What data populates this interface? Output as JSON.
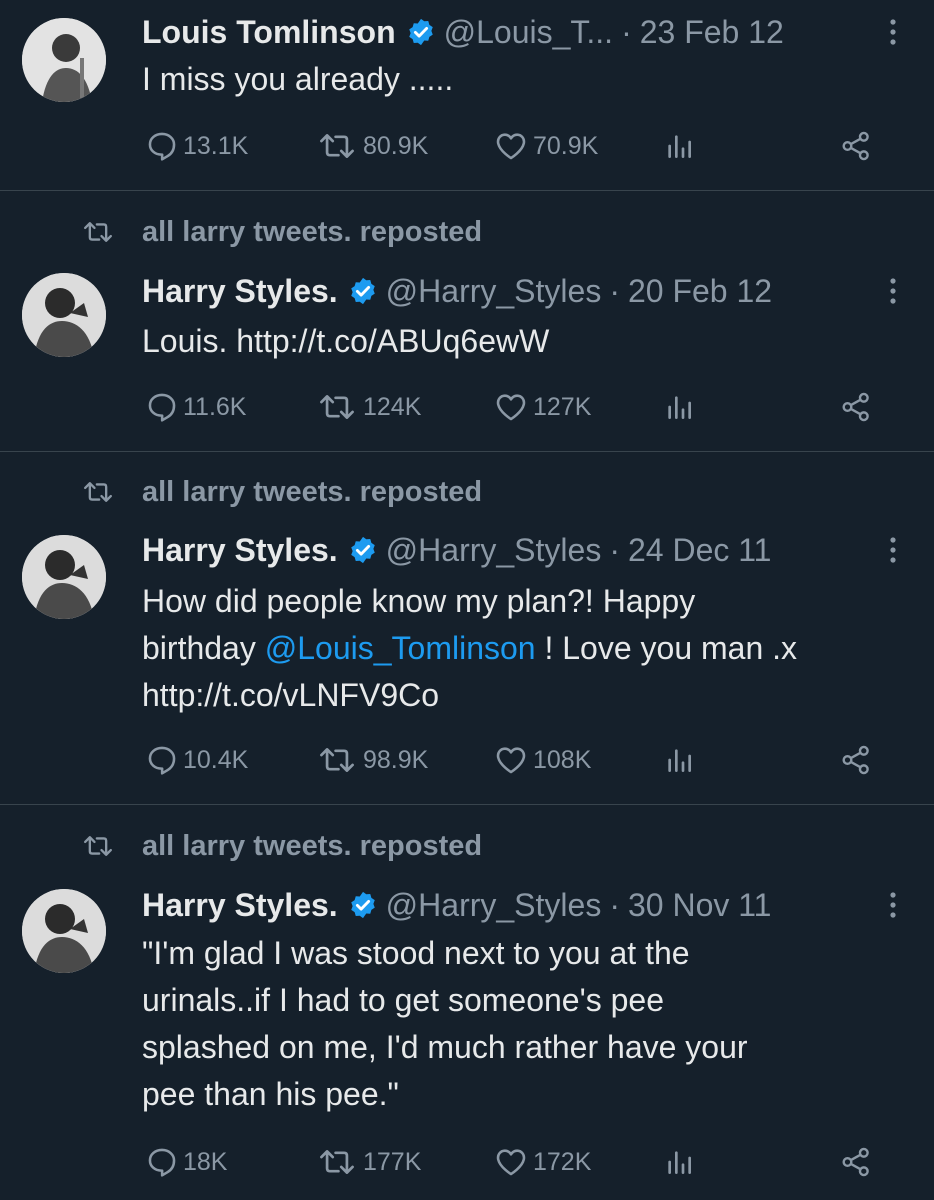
{
  "tweets": [
    {
      "repost_label": "",
      "name": "Louis Tomlinson",
      "handle": "@Louis_T...",
      "date": "23 Feb 12",
      "text_before": "I miss you already .....",
      "mention": "",
      "text_after": "",
      "replies": "13.1K",
      "reposts": "80.9K",
      "likes": "70.9K"
    },
    {
      "repost_label": "all larry tweets. reposted",
      "name": "Harry Styles.",
      "handle": "@Harry_Styles",
      "date": "20 Feb 12",
      "text_before": "Louis. http://t.co/ABUq6ewW",
      "mention": "",
      "text_after": "",
      "replies": "11.6K",
      "reposts": "124K",
      "likes": "127K"
    },
    {
      "repost_label": "all larry tweets. reposted",
      "name": "Harry Styles.",
      "handle": "@Harry_Styles",
      "date": "24 Dec 11",
      "text_before": "How did people know my plan?! Happy\nbirthday ",
      "mention": "@Louis_Tomlinson",
      "text_after": " ! Love you man .x\nhttp://t.co/vLNFV9Co",
      "replies": "10.4K",
      "reposts": "98.9K",
      "likes": "108K"
    },
    {
      "repost_label": "all larry tweets. reposted",
      "name": "Harry Styles.",
      "handle": "@Harry_Styles",
      "date": "30 Nov 11",
      "text_before": "\"I'm glad I was stood next to you at the\nurinals..if I had to get someone's pee\nsplashed on me, I'd much rather have your\npee than his pee.\"",
      "mention": "",
      "text_after": "",
      "replies": "18K",
      "reposts": "177K",
      "likes": "172K"
    }
  ],
  "separator": "·",
  "colors": {
    "background": "#15202b",
    "text": "#e7e9ea",
    "muted": "#8b98a5",
    "link": "#1d9bf0",
    "verified": "#1d9bf0"
  }
}
